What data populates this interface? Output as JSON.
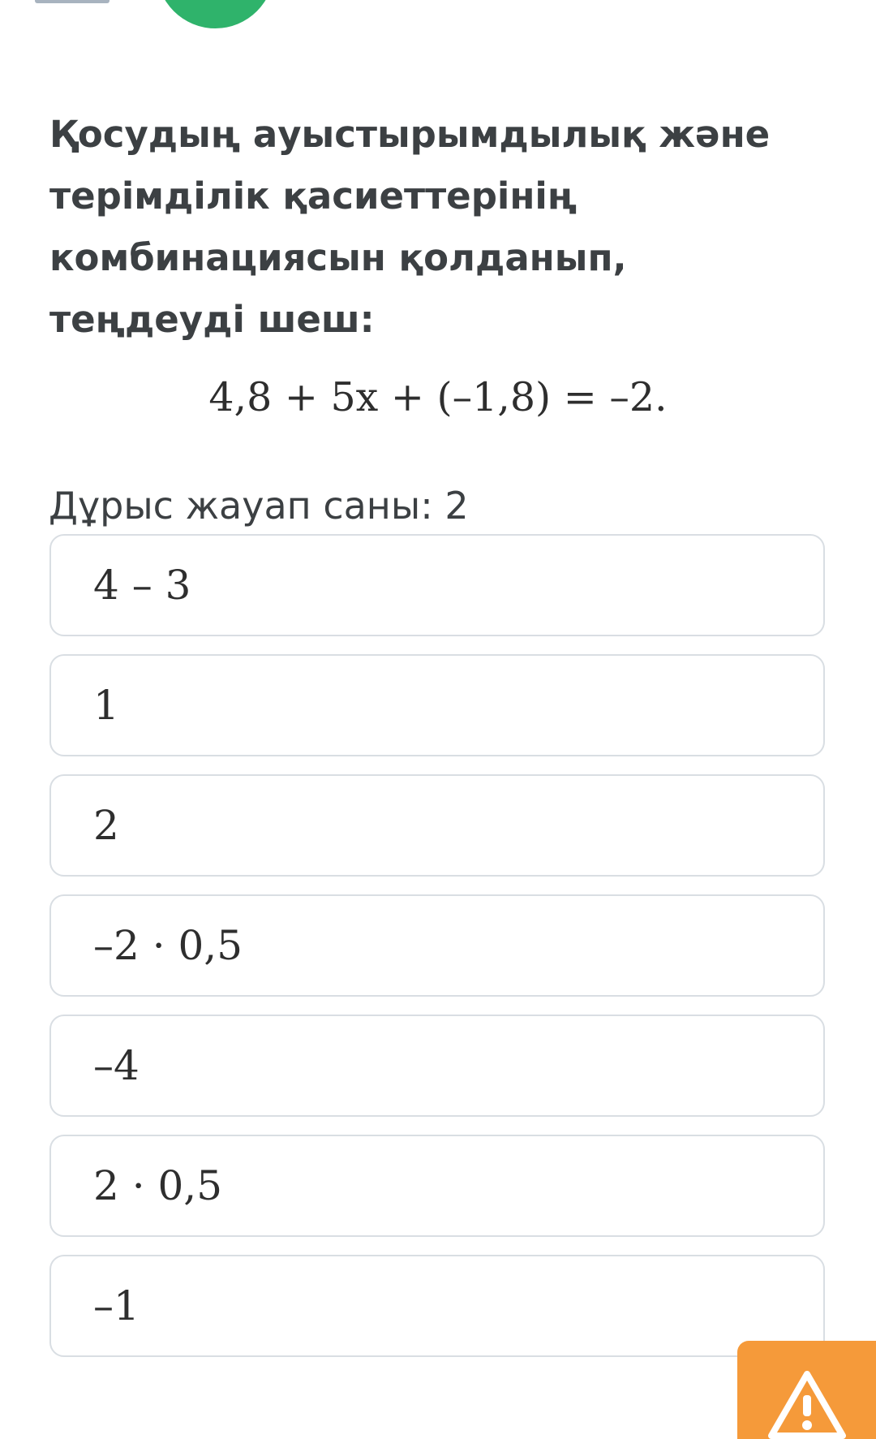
{
  "question": {
    "title": "Қосудың ауыстырымдылық және терімділік қасиеттерінің комбинациясын қолданып, теңдеуді шеш:",
    "equation": "4,8 + 5x + (–1,8) = –2."
  },
  "hint": "Дұрыс жауап саны: 2",
  "options": [
    {
      "label": "4 – 3"
    },
    {
      "label": "1"
    },
    {
      "label": "2"
    },
    {
      "label": "–2 · 0,5"
    },
    {
      "label": "–4"
    },
    {
      "label": "2 · 0,5"
    },
    {
      "label": "–1"
    }
  ],
  "report_button": {
    "icon": "warning-icon"
  },
  "colors": {
    "accent_green": "#2fb36b",
    "report_orange": "#f59a3a",
    "option_border": "#d9dee3",
    "text": "#3c4043"
  }
}
